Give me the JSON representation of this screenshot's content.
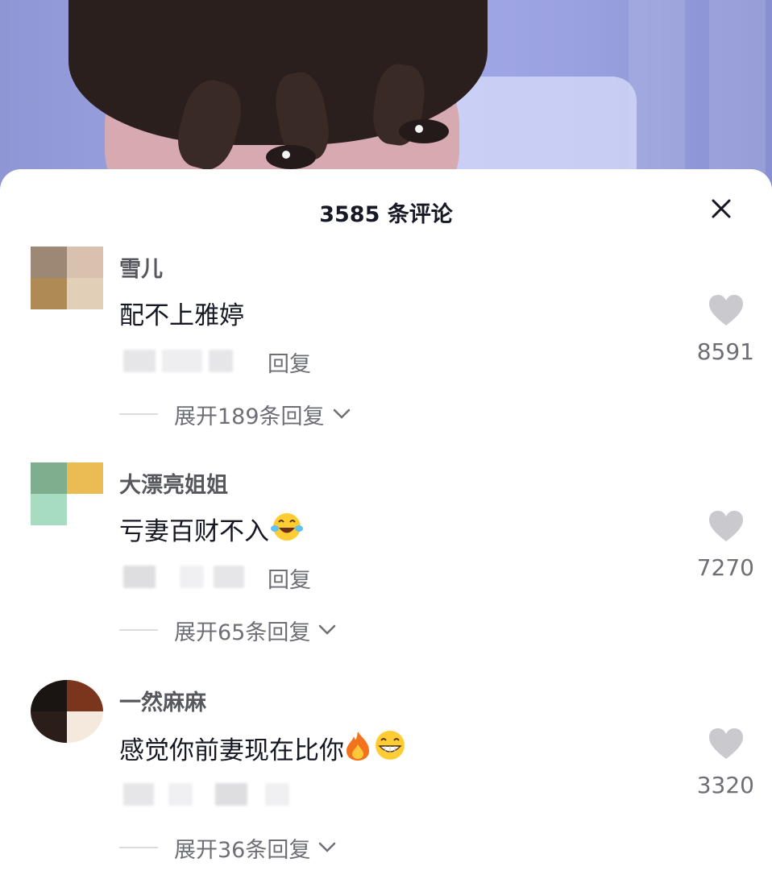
{
  "header": {
    "comment_count_title": "3585 条评论",
    "close_icon": "close-icon"
  },
  "comments": [
    {
      "username": "雪儿",
      "text": "配不上雅婷",
      "reply_label": "回复",
      "like_count": "8591",
      "expand_label": "展开189条回复"
    },
    {
      "username": "大漂亮姐姐",
      "text": "亏妻百财不入",
      "emojis": [
        "laughing-crying-emoji"
      ],
      "reply_label": "回复",
      "like_count": "7270",
      "expand_label": "展开65条回复"
    },
    {
      "username": "一然麻麻",
      "text": "感觉你前妻现在比你",
      "emojis": [
        "fire-emoji",
        "grinning-emoji"
      ],
      "like_count": "3320",
      "expand_label": "展开36条回复"
    }
  ],
  "colors": {
    "text_primary": "#161823",
    "text_secondary": "#6e6f76",
    "like_icon": "#c9c9ce",
    "video_background": "#a6acec"
  }
}
